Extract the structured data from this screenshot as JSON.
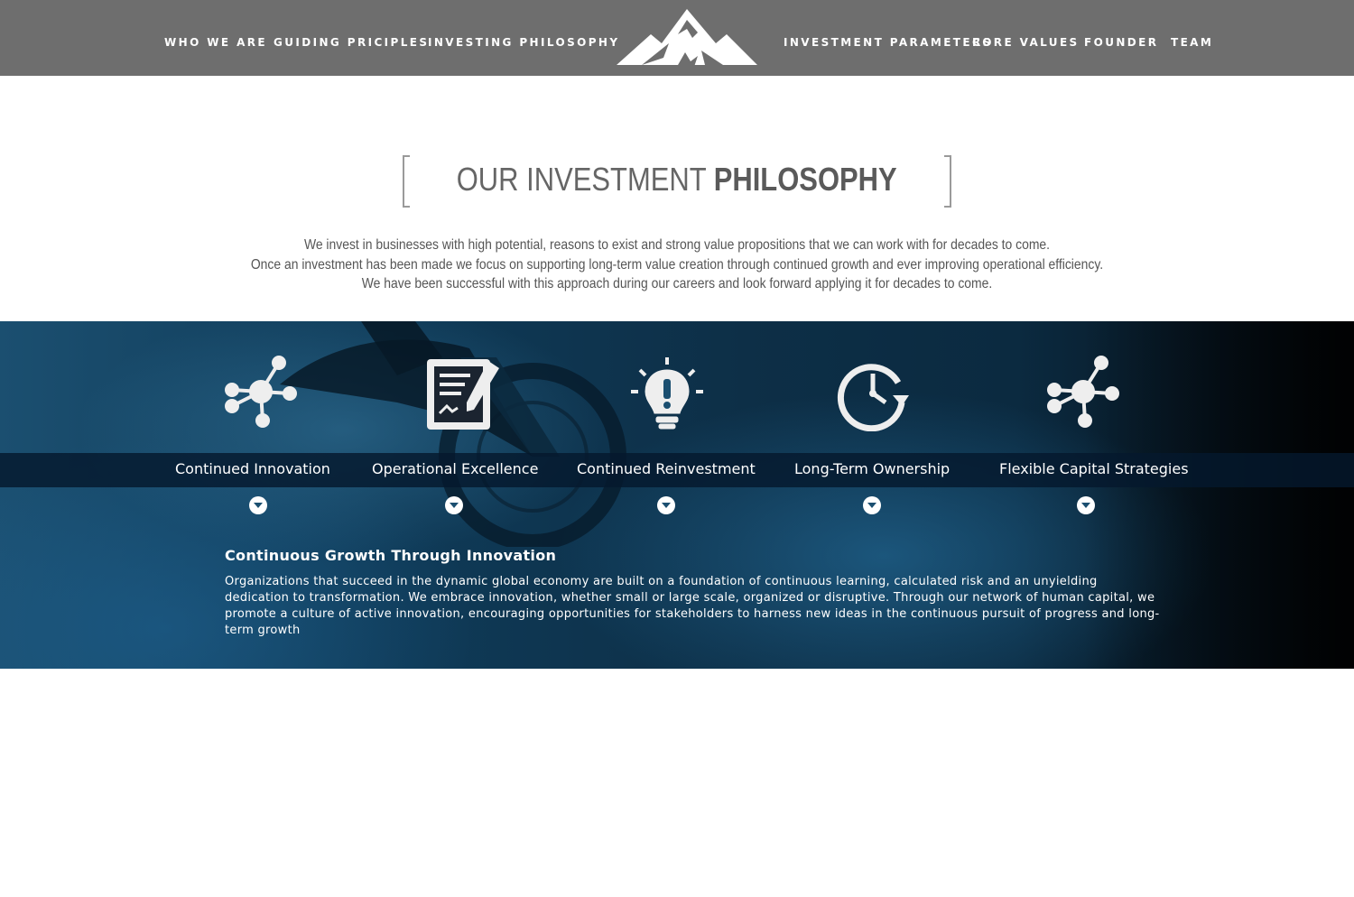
{
  "nav": {
    "left": [
      "WHO WE ARE",
      "GUIDING PRICIPLES",
      "INVESTING PHILOSOPHY"
    ],
    "right": [
      "INVESTMENT PARAMETERS",
      "CORE VALUES",
      "FOUNDER",
      "TEAM"
    ],
    "logo_icon": "mountain-logo"
  },
  "heading": {
    "light": "OUR INVESTMENT ",
    "bold": "PHILOSOPHY"
  },
  "intro": [
    "We invest in businesses with high potential, reasons to exist and strong value propositions that we can work with for decades to come.",
    "Once an investment has been made we focus on supporting long-term value creation through continued growth and ever improving operational efficiency.",
    "We have been successful with this approach during our careers and look forward applying it for decades to come."
  ],
  "features": [
    {
      "label": "Continued Innovation",
      "icon": "network-icon"
    },
    {
      "label": "Operational Excellence",
      "icon": "document-sign-icon"
    },
    {
      "label": "Continued Reinvestment",
      "icon": "lightbulb-icon"
    },
    {
      "label": "Long-Term Ownership",
      "icon": "clock-icon"
    },
    {
      "label": "Flexible Capital Strategies",
      "icon": "network-icon"
    }
  ],
  "detail": {
    "title": "Continuous Growth Through Innovation",
    "body": "Organizations that succeed in the dynamic global economy are built on a foundation of continuous learning, calculated risk and an unyielding dedication to transformation. We embrace innovation, whether small or large scale, organized or disruptive.  Through our network of human capital, we promote a culture of active innovation, encouraging opportunities for stakeholders to harness new ideas in the continuous pursuit of progress and long-term growth"
  },
  "colors": {
    "header_bg": "#6e6e6e",
    "hero_blue": "#1b4f70",
    "label_strip": "#05192d"
  }
}
